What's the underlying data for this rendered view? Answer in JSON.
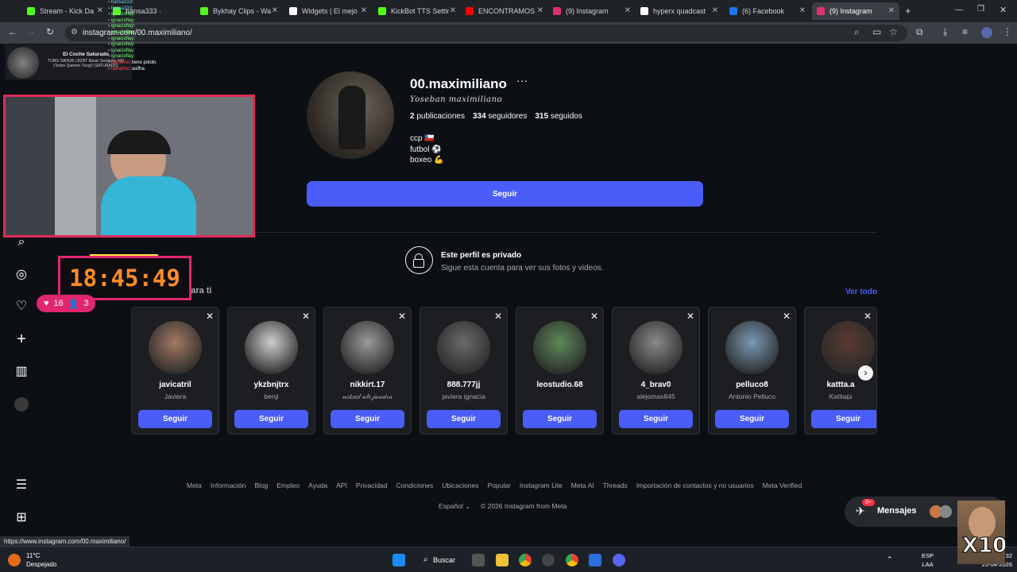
{
  "browser": {
    "tabs": [
      {
        "title": "Stream - Kick Da",
        "color": "#53fc18"
      },
      {
        "title": "hansa333 ·",
        "color": "#53fc18"
      },
      {
        "title": "Bykhay Clips - Wa",
        "color": "#53fc18"
      },
      {
        "title": "Widgets | El mejo",
        "color": "#ffffff"
      },
      {
        "title": "KickBot TTS Settir",
        "color": "#53fc18"
      },
      {
        "title": "ENCONTRAMOS",
        "color": "#ff0000"
      },
      {
        "title": "(9) Instagram",
        "color": "#e1306c"
      },
      {
        "title": "hyperx quadcast",
        "color": "#ffffff"
      },
      {
        "title": "(6) Facebook",
        "color": "#1877f2"
      },
      {
        "title": "(9) Instagram",
        "color": "#e1306c"
      }
    ],
    "new_tab": "+",
    "address": "instagram.com/00.maximiliano/",
    "status_url": "https://www.instagram.com/00.maximiliano/"
  },
  "profile": {
    "username": "00.maximiliano",
    "more": "···",
    "full_name": "Yoseban maximiliano",
    "posts_count": "2",
    "posts_label": "publicaciones",
    "followers_count": "334",
    "followers_label": "seguidores",
    "following_count": "315",
    "following_label": "seguidos",
    "bio": [
      "ccp 🇨🇱",
      "futbol ⚽",
      "boxeo 💪"
    ],
    "follow_button": "Seguir"
  },
  "private": {
    "title": "Este perfil es privado",
    "subtitle": "Sigue esta cuenta para ver sus fotos y videos."
  },
  "suggestions": {
    "title": "Sugerencias para ti",
    "see_all": "Ver todo",
    "close": "✕",
    "next": "›",
    "items": [
      {
        "username": "javicatril",
        "name": "Javiera",
        "button": "Seguir",
        "color": "#a27a63"
      },
      {
        "username": "ykzbnjtrx",
        "name": "benji",
        "button": "Seguir",
        "color": "#cfcfcf"
      },
      {
        "username": "nikkirt.17",
        "name": "𝓃𝒾𝓀𝑜𝑜𝓁 𝒶𝓁𝑒𝒿𝒶𝓃𝒹𝓇𝒶",
        "button": "Seguir",
        "color": "#9a9a9a"
      },
      {
        "username": "888.777jj",
        "name": "javiera ignacia",
        "button": "Seguir",
        "color": "#6a6a6a"
      },
      {
        "username": "leostudio.68",
        "name": "",
        "button": "Seguir",
        "color": "#5e8a5a"
      },
      {
        "username": "4_brav0",
        "name": "alejomax845",
        "button": "Seguir",
        "color": "#8a8a8a"
      },
      {
        "username": "pelluco8",
        "name": "Antonio Pelluco",
        "button": "Seguir",
        "color": "#7a9ab5"
      },
      {
        "username": "kattta.a",
        "name": "Katita(̶̶ͻ",
        "button": "Seguir",
        "color": "#5a3a30"
      }
    ]
  },
  "footer": {
    "links": [
      "Meta",
      "Información",
      "Blog",
      "Empleo",
      "Ayuda",
      "API",
      "Privacidad",
      "Condiciones",
      "Ubicaciones",
      "Popular",
      "Instagram Lite",
      "Meta AI",
      "Threads",
      "Importación de contactos y no usuarios",
      "Meta Verified"
    ],
    "language": "Español ⌄",
    "copyright": "© 2026 Instagram from Meta"
  },
  "messages": {
    "label": "Mensajes",
    "badge": "9+"
  },
  "overlay": {
    "music_title": "El Coche Saturado",
    "music_sub": "TUNG SAHUR | BZRT Music Sessions #62 (Todos Quieren Tung!) (SATURADO)",
    "chat": [
      {
        "user": "hansa333",
        "msg": ":",
        "color": "#6cf"
      },
      {
        "user": "hansa333",
        "msg": ":",
        "color": "#6cf"
      },
      {
        "user": "ignacioflay",
        "msg": ":",
        "color": "#7cff7c"
      },
      {
        "user": "ignacioflay",
        "msg": ":",
        "color": "#7cff7c"
      },
      {
        "user": "ignacioflay",
        "msg": ":",
        "color": "#7cff7c"
      },
      {
        "user": "ignacioflay",
        "msg": ":",
        "color": "#7cff7c"
      },
      {
        "user": "ignacioflay",
        "msg": ":",
        "color": "#7cff7c"
      },
      {
        "user": "ignacioflay",
        "msg": ":",
        "color": "#7cff7c"
      },
      {
        "user": "ignacioflay",
        "msg": ":",
        "color": "#7cff7c"
      },
      {
        "user": "ignacioflay",
        "msg": ":",
        "color": "#7cff7c"
      },
      {
        "user": "fijandme",
        "msg": ": tiene pololo",
        "color": "#ff4a4a"
      },
      {
        "user": "fijandme",
        "msg": ": asifha",
        "color": "#ff4a4a"
      }
    ],
    "clock": "18:45:49",
    "likes": "16",
    "viewers": "3",
    "x10": "X10"
  },
  "taskbar": {
    "temp": "11°C",
    "weather": "Despejado",
    "search": "Buscar",
    "lang1": "ESP",
    "lang2": "LAA",
    "time": "32",
    "date": "25-04-2026"
  }
}
